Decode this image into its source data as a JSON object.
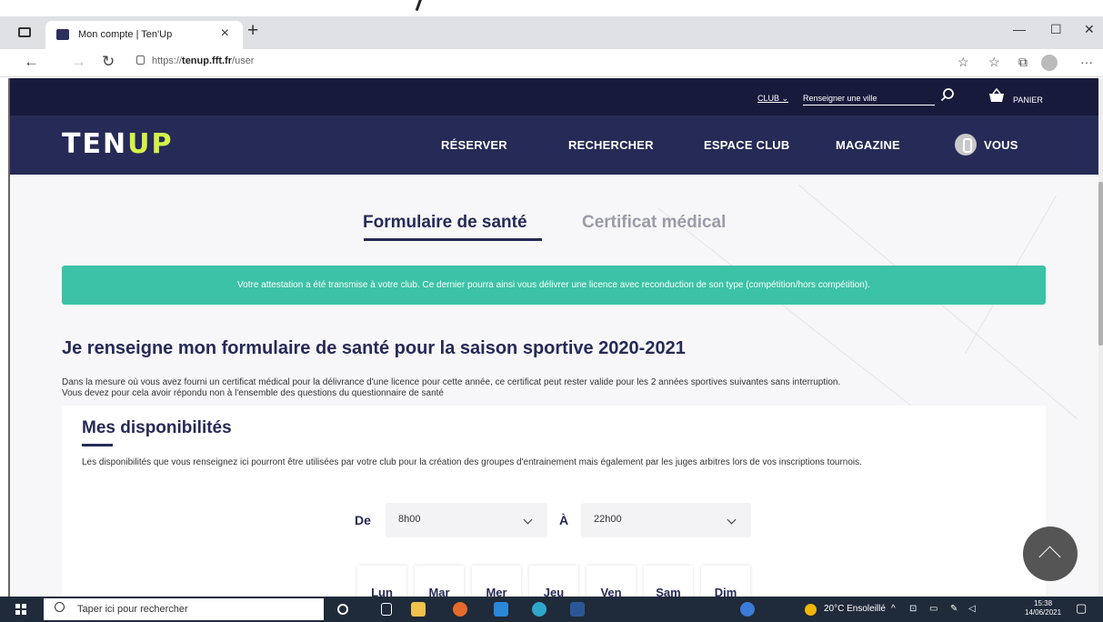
{
  "browser": {
    "tab_title": "Mon compte | Ten'Up",
    "url_prefix": "https://",
    "url_domain": "tenup.fft.fr",
    "url_path": "/user"
  },
  "utility_bar": {
    "club_select": "CLUB ⌄",
    "city_placeholder": "Renseigner une ville",
    "cart_label": "PANIER"
  },
  "nav": {
    "logo_ten": "TEN",
    "logo_up": "UP",
    "links": [
      "RÉSERVER",
      "RECHERCHER",
      "ESPACE CLUB",
      "MAGAZINE"
    ],
    "account": "VOUS"
  },
  "tabs": {
    "active": "Formulaire de santé",
    "inactive": "Certificat médical"
  },
  "alert": "Votre attestation a été transmise à votre club. Ce dernier pourra ainsi vous délivrer une licence avec reconduction de son type (compétition/hors compétition).",
  "health": {
    "title": "Je renseigne mon formulaire de santé pour la saison sportive 2020-2021",
    "desc_line1": "Dans la mesure où vous avez fourni un certificat médical pour la délivrance d'une licence pour cette année, ce certificat peut rester valide pour les 2 années sportives suivantes sans interruption.",
    "desc_line2": "Vous devez pour cela avoir répondu non à l'ensemble des questions du questionnaire de santé"
  },
  "availability": {
    "title": "Mes disponibilités",
    "desc": "Les disponibilités que vous renseignez ici pourront être utilisées par votre club pour la création des groupes d'entrainement mais également par les juges arbitres lors de vos inscriptions tournois.",
    "from_label": "De",
    "from_value": "8h00",
    "to_label": "À",
    "to_value": "22h00",
    "days": [
      "Lun",
      "Mar",
      "Mer",
      "Jeu",
      "Ven",
      "Sam",
      "Dim"
    ]
  },
  "taskbar": {
    "search_placeholder": "Taper ici pour rechercher",
    "weather": "20°C  Ensoleillé",
    "time": "15:38",
    "date": "14/06/2021"
  },
  "colors": {
    "navy": "#262a56",
    "dark_navy": "#171a3b",
    "teal": "#3cc2a7",
    "lime": "#d4f24a"
  }
}
